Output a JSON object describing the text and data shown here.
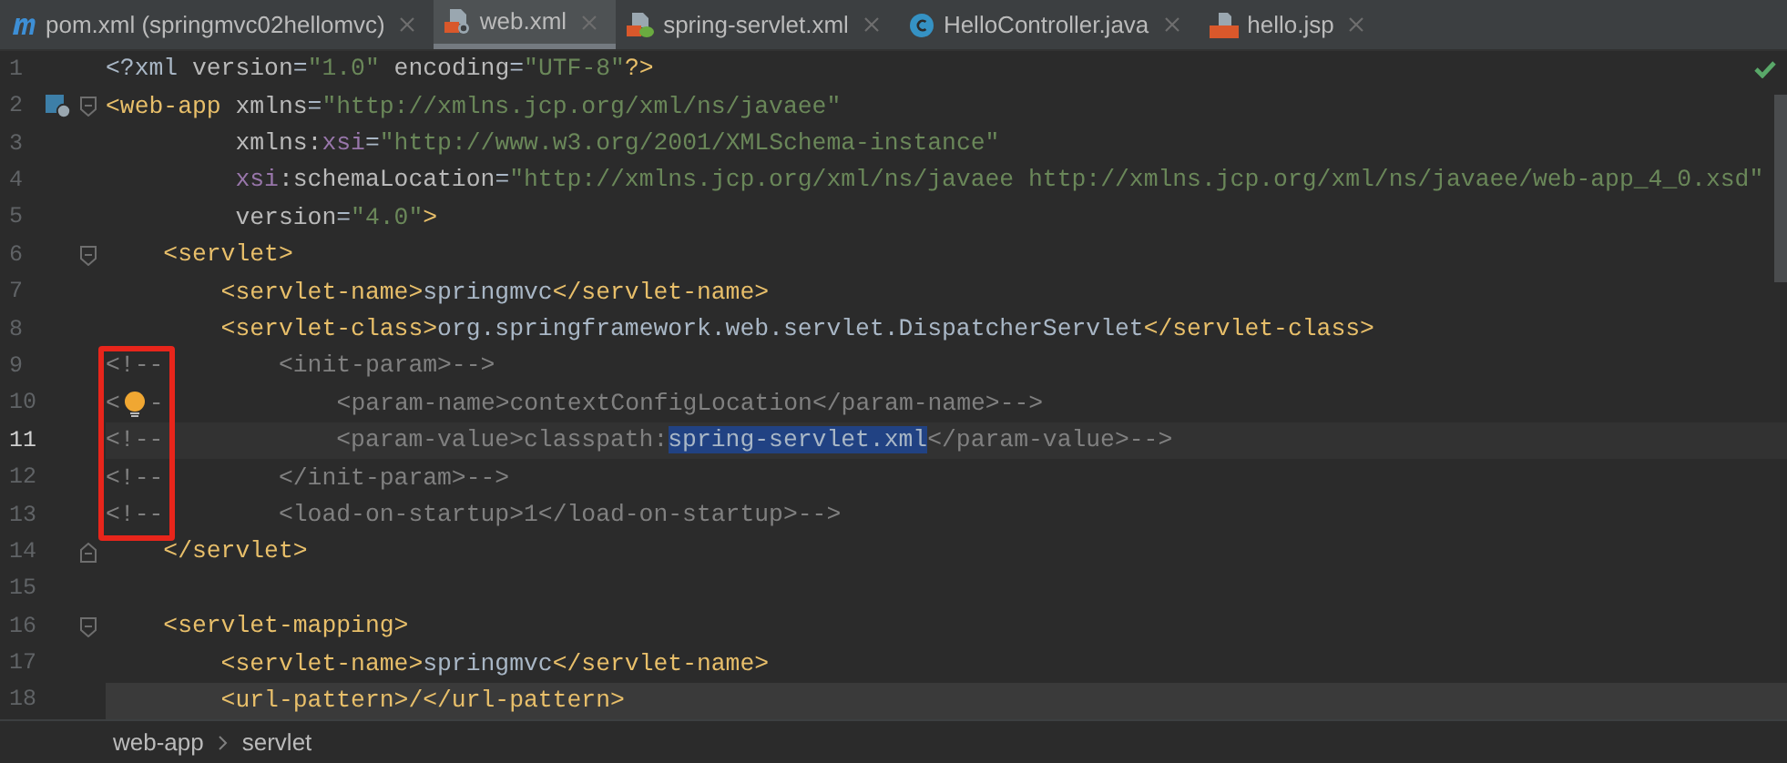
{
  "tabs": [
    {
      "label": "pom.xml (springmvc02hellomvc)",
      "kind": "maven",
      "selected": false
    },
    {
      "label": "web.xml",
      "kind": "xml",
      "selected": true
    },
    {
      "label": "spring-servlet.xml",
      "kind": "spring",
      "selected": false
    },
    {
      "label": "HelloController.java",
      "kind": "java",
      "selected": false
    },
    {
      "label": "hello.jsp",
      "kind": "jsp",
      "selected": false
    }
  ],
  "editor": {
    "no_problems": true,
    "lines": [
      {
        "number": "1",
        "tokens": [
          {
            "text": "<?xml ",
            "kind": "x"
          },
          {
            "text": "version",
            "kind": "a"
          },
          {
            "text": "=",
            "kind": "x"
          },
          {
            "text": "\"1.0\"",
            "kind": "v"
          },
          {
            "text": " encoding",
            "kind": "a"
          },
          {
            "text": "=",
            "kind": "x"
          },
          {
            "text": "\"UTF-8\"",
            "kind": "v"
          },
          {
            "text": "?>",
            "kind": "t"
          }
        ]
      },
      {
        "number": "2",
        "fold_start": true,
        "gutter_icon": true,
        "tokens": [
          {
            "text": "<web-app",
            "kind": "t"
          },
          {
            "text": " xmlns",
            "kind": "a"
          },
          {
            "text": "=",
            "kind": "x"
          },
          {
            "text": "\"http://xmlns.jcp.org/xml/ns/javaee\"",
            "kind": "v"
          }
        ]
      },
      {
        "number": "3",
        "tokens": [
          {
            "text": "         xmlns:",
            "kind": "a"
          },
          {
            "text": "xsi",
            "kind": "n"
          },
          {
            "text": "=",
            "kind": "x"
          },
          {
            "text": "\"http://www.w3.org/2001/XMLSchema-instance\"",
            "kind": "v"
          }
        ]
      },
      {
        "number": "4",
        "tokens": [
          {
            "text": "         xsi",
            "kind": "n"
          },
          {
            "text": ":schemaLocation",
            "kind": "a"
          },
          {
            "text": "=",
            "kind": "x"
          },
          {
            "text": "\"http://xmlns.jcp.org/xml/ns/javaee http://xmlns.jcp.org/xml/ns/javaee/web-app_4_0.xsd\"",
            "kind": "v"
          }
        ]
      },
      {
        "number": "5",
        "tokens": [
          {
            "text": "         version",
            "kind": "a"
          },
          {
            "text": "=",
            "kind": "x"
          },
          {
            "text": "\"4.0\"",
            "kind": "v"
          },
          {
            "text": ">",
            "kind": "t"
          }
        ]
      },
      {
        "number": "6",
        "fold_start": true,
        "tokens": [
          {
            "text": "    <servlet>",
            "kind": "t"
          }
        ]
      },
      {
        "number": "7",
        "tokens": [
          {
            "text": "        <servlet-name>",
            "kind": "t"
          },
          {
            "text": "springmvc",
            "kind": "x"
          },
          {
            "text": "</servlet-name>",
            "kind": "t"
          }
        ]
      },
      {
        "number": "8",
        "tokens": [
          {
            "text": "        <servlet-class>",
            "kind": "t"
          },
          {
            "text": "org.springframework.web.servlet.DispatcherServlet",
            "kind": "x"
          },
          {
            "text": "</servlet-class>",
            "kind": "t"
          }
        ]
      },
      {
        "number": "9",
        "boxed": true,
        "tokens": [
          {
            "text": "<!--        <init-param>-->",
            "kind": "c"
          }
        ]
      },
      {
        "number": "10",
        "boxed": true,
        "bulb": true,
        "tokens": [
          {
            "text": "<",
            "kind": "c"
          },
          {
            "text": "-            <param-name>contextConfigLocation</param-name>-->",
            "kind": "c"
          }
        ]
      },
      {
        "number": "11",
        "boxed": true,
        "caret": true,
        "tokens": [
          {
            "text": "<!--            <param-value>classpath:",
            "kind": "c"
          },
          {
            "text": "spring-servlet.xml",
            "kind": "s"
          },
          {
            "text": "</param-value>-->",
            "kind": "c"
          }
        ]
      },
      {
        "number": "12",
        "boxed": true,
        "tokens": [
          {
            "text": "<!--        </init-param>-->",
            "kind": "c"
          }
        ]
      },
      {
        "number": "13",
        "boxed": true,
        "tokens": [
          {
            "text": "<!--        <load-on-startup>1</load-on-startup>-->",
            "kind": "c"
          }
        ]
      },
      {
        "number": "14",
        "fold_end": true,
        "tokens": [
          {
            "text": "    </servlet>",
            "kind": "t"
          }
        ]
      },
      {
        "number": "15"
      },
      {
        "number": "16",
        "fold_start": true,
        "tokens": [
          {
            "text": "    <servlet-mapping>",
            "kind": "t"
          }
        ]
      },
      {
        "number": "17",
        "tokens": [
          {
            "text": "        <servlet-name>",
            "kind": "t"
          },
          {
            "text": "springmvc",
            "kind": "x"
          },
          {
            "text": "</servlet-name>",
            "kind": "t"
          }
        ]
      },
      {
        "number": "18",
        "highlighted": true,
        "tokens": [
          {
            "text": "        <url-pattern>/</url-pattern>",
            "kind": "t"
          }
        ]
      }
    ]
  },
  "breadcrumbs": [
    "web-app",
    "servlet"
  ]
}
